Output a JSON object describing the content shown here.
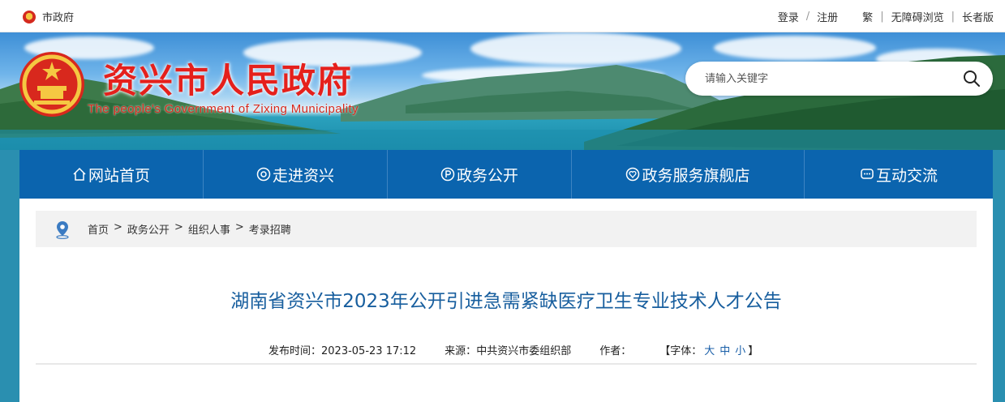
{
  "topbar": {
    "site_link": "市政府",
    "login": "登录",
    "login_sep": "/",
    "register": "注册",
    "traditional": "繁",
    "accessible": "无障碍浏览",
    "elder": "长者版",
    "divider": "|"
  },
  "banner": {
    "title_cn": "资兴市人民政府",
    "title_en": "The people's Government of Zixing Municipality",
    "search_placeholder": "请输入关键字"
  },
  "nav": {
    "items": [
      {
        "label": "网站首页",
        "icon": "home-icon"
      },
      {
        "label": "走进资兴",
        "icon": "target-icon"
      },
      {
        "label": "政务公开",
        "icon": "p-circle-icon"
      },
      {
        "label": "政务服务旗舰店",
        "icon": "heart-circle-icon"
      },
      {
        "label": "互动交流",
        "icon": "chat-icon"
      }
    ]
  },
  "breadcrumb": {
    "items": [
      "首页",
      "政务公开",
      "组织人事",
      "考录招聘"
    ],
    "sep": ">"
  },
  "article": {
    "title": "湖南省资兴市2023年公开引进急需紧缺医疗卫生专业技术人才公告",
    "published_label": "发布时间：",
    "published": "2023-05-23 17:12",
    "source_label": "来源：",
    "source": "中共资兴市委组织部",
    "author_label": "作者：",
    "author": "",
    "font_label": "【字体：",
    "font_large": "大",
    "font_medium": "中",
    "font_small": "小",
    "font_close": "】"
  },
  "colors": {
    "nav_bg": "#0b64ae",
    "title_blue": "#175e9e",
    "brand_red": "#e5201c"
  }
}
